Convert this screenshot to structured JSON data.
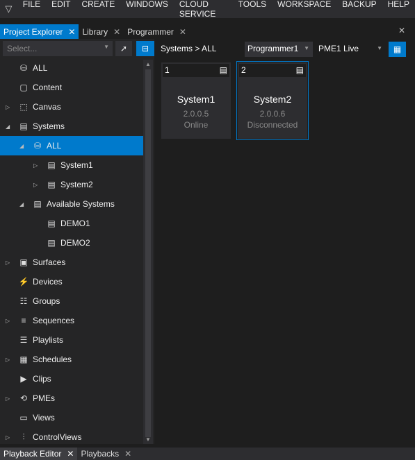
{
  "menu": [
    "FILE",
    "EDIT",
    "CREATE",
    "WINDOWS",
    "CLOUD SERVICE",
    "TOOLS",
    "WORKSPACE",
    "BACKUP",
    "HELP"
  ],
  "tabs": [
    {
      "label": "Project Explorer",
      "active": true
    },
    {
      "label": "Library"
    },
    {
      "label": "Programmer"
    }
  ],
  "explorer": {
    "select_placeholder": "Select...",
    "tree": [
      {
        "label": "ALL",
        "icon": "database-icon",
        "level": 0,
        "arrow": ""
      },
      {
        "label": "Content",
        "icon": "content-icon",
        "level": 0,
        "arrow": ""
      },
      {
        "label": "Canvas",
        "icon": "canvas-icon",
        "level": 0,
        "arrow": "collapsed"
      },
      {
        "label": "Systems",
        "icon": "server-icon",
        "level": 0,
        "arrow": "expanded"
      },
      {
        "label": "ALL",
        "icon": "database-icon",
        "level": 1,
        "arrow": "expanded",
        "selected": true
      },
      {
        "label": "System1",
        "icon": "server-icon",
        "level": 2,
        "arrow": "collapsed"
      },
      {
        "label": "System2",
        "icon": "server-icon",
        "level": 2,
        "arrow": "collapsed"
      },
      {
        "label": "Available Systems",
        "icon": "server-icon",
        "level": 1,
        "arrow": "expanded"
      },
      {
        "label": "DEMO1",
        "icon": "server-icon",
        "level": 2,
        "arrow": ""
      },
      {
        "label": "DEMO2",
        "icon": "server-icon",
        "level": 2,
        "arrow": ""
      },
      {
        "label": "Surfaces",
        "icon": "surface-icon",
        "level": 0,
        "arrow": "collapsed"
      },
      {
        "label": "Devices",
        "icon": "plug-icon",
        "level": 0,
        "arrow": ""
      },
      {
        "label": "Groups",
        "icon": "groups-icon",
        "level": 0,
        "arrow": ""
      },
      {
        "label": "Sequences",
        "icon": "sequence-icon",
        "level": 0,
        "arrow": "collapsed"
      },
      {
        "label": "Playlists",
        "icon": "playlist-icon",
        "level": 0,
        "arrow": ""
      },
      {
        "label": "Schedules",
        "icon": "calendar-icon",
        "level": 0,
        "arrow": "collapsed"
      },
      {
        "label": "Clips",
        "icon": "clip-icon",
        "level": 0,
        "arrow": ""
      },
      {
        "label": "PMEs",
        "icon": "pme-icon",
        "level": 0,
        "arrow": "collapsed"
      },
      {
        "label": "Views",
        "icon": "views-icon",
        "level": 0,
        "arrow": ""
      },
      {
        "label": "ControlViews",
        "icon": "sliders-icon",
        "level": 0,
        "arrow": "collapsed"
      }
    ]
  },
  "main": {
    "breadcrumb": "Systems > ALL",
    "programmer": "Programmer1",
    "pme": "PME1 Live",
    "cards": [
      {
        "id": "1",
        "name": "System1",
        "version": "2.0.0.5",
        "status": "Online"
      },
      {
        "id": "2",
        "name": "System2",
        "version": "2.0.0.6",
        "status": "Disconnected",
        "selected": true
      }
    ]
  },
  "bottom_tabs": [
    {
      "label": "Playback Editor",
      "active": true
    },
    {
      "label": "Playbacks"
    }
  ],
  "colors": {
    "accent": "#007acc"
  }
}
